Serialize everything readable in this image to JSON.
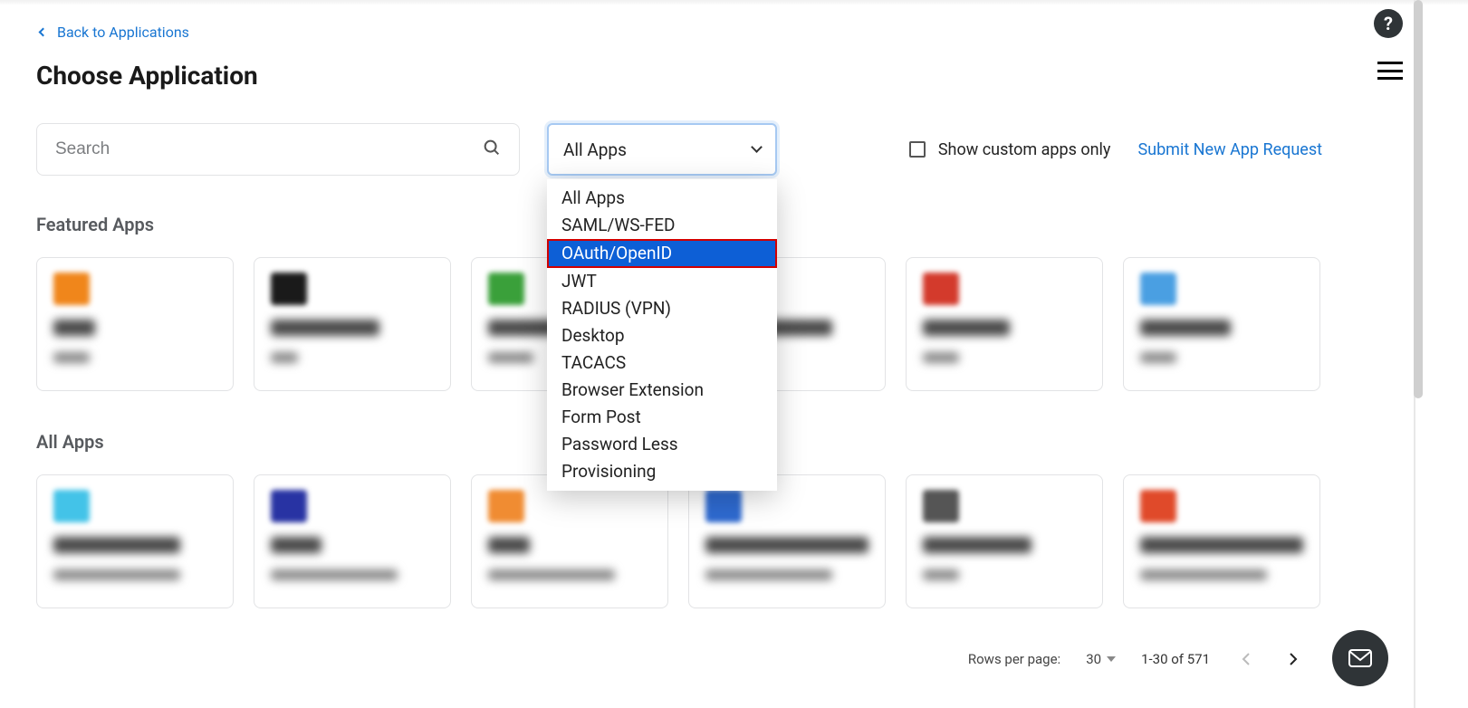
{
  "back_link": "Back to Applications",
  "page_title": "Choose Application",
  "search": {
    "placeholder": "Search"
  },
  "filter_select": {
    "selected": "All Apps",
    "options": [
      "All Apps",
      "SAML/WS-FED",
      "OAuth/OpenID",
      "JWT",
      "RADIUS (VPN)",
      "Desktop",
      "TACACS",
      "Browser Extension",
      "Form Post",
      "Password Less",
      "Provisioning"
    ],
    "highlighted": "OAuth/OpenID"
  },
  "show_custom_only_label": "Show custom apps only",
  "submit_link": "Submit New App Request",
  "sections": {
    "featured_title": "Featured Apps",
    "all_title": "All Apps"
  },
  "featured_cards": [
    {
      "icon_color": "#f0861b",
      "name_w": 46,
      "type_w": 40
    },
    {
      "icon_color": "#1a1a1a",
      "name_w": 120,
      "type_w": 30
    },
    {
      "icon_color": "#3aa03a",
      "name_w": 80,
      "type_w": 50
    },
    {
      "icon_color": "#1a1a1a",
      "name_w": 140,
      "type_w": 0
    },
    {
      "icon_color": "#d33a2c",
      "name_w": 96,
      "type_w": 40
    },
    {
      "icon_color": "#4a9fe2",
      "name_w": 100,
      "type_w": 40
    }
  ],
  "all_cards": [
    {
      "icon_color": "#43c3e8",
      "name_w": 140,
      "type_w": 140
    },
    {
      "icon_color": "#2833a3",
      "name_w": 56,
      "type_w": 140
    },
    {
      "icon_color": "#f08c32",
      "name_w": 46,
      "type_w": 140
    },
    {
      "icon_color": "#2e6ad0",
      "name_w": 180,
      "type_w": 140
    },
    {
      "icon_color": "#555555",
      "name_w": 120,
      "type_w": 40
    },
    {
      "icon_color": "#e04a2a",
      "name_w": 180,
      "type_w": 140
    }
  ],
  "pagination": {
    "rows_label": "Rows per page:",
    "per_page": "30",
    "range": "1-30 of 571"
  }
}
